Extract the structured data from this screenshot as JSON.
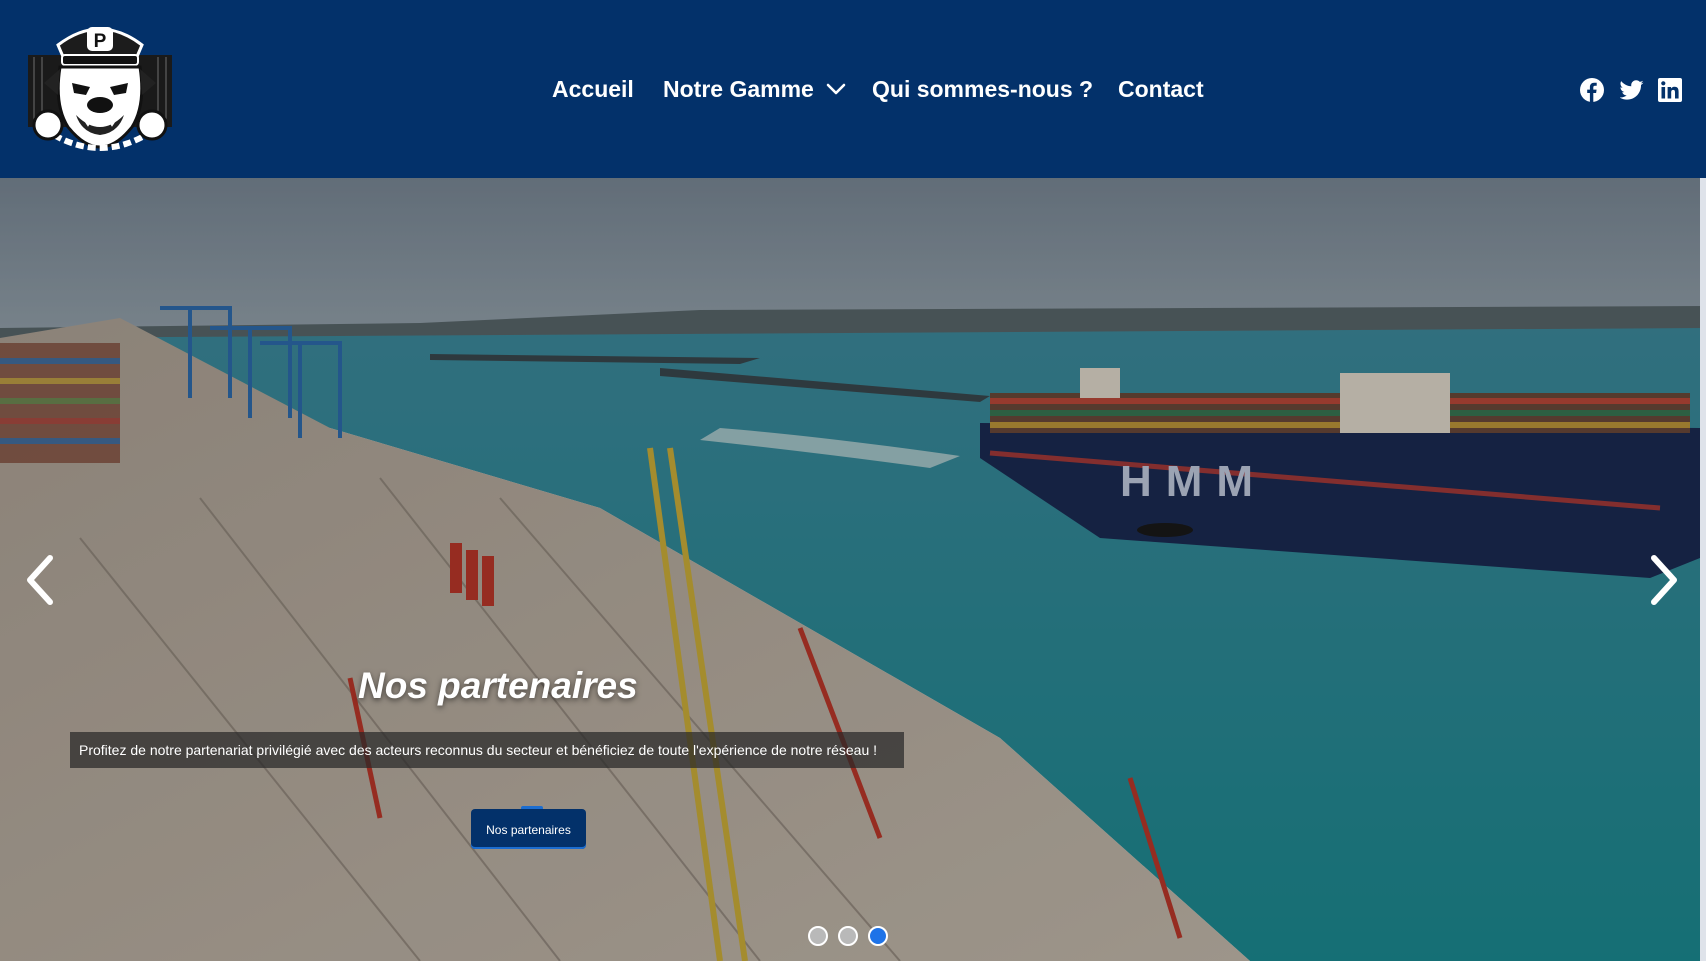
{
  "header": {
    "background_color": "#03316a",
    "logo": {
      "name": "bulldog-police-logo",
      "letter": "P"
    },
    "nav": {
      "accueil": "Accueil",
      "notre_gamme": "Notre Gamme",
      "qui_sommes_nous": "Qui sommes-nous ?",
      "contact": "Contact"
    },
    "social": [
      "facebook-icon",
      "twitter-icon",
      "linkedin-icon"
    ]
  },
  "hero": {
    "image": "aerial-port-container-ship-photo",
    "title": "Nos partenaires",
    "description": "Profitez de notre partenariat privilégié avec des acteurs reconnus du secteur et bénéficiez de toute l'expérience de notre réseau !",
    "button_label": "Nos partenaires",
    "ship_text": "HMM",
    "slides_count": 3,
    "active_slide": 3,
    "accent_color": "#1e73e8"
  }
}
